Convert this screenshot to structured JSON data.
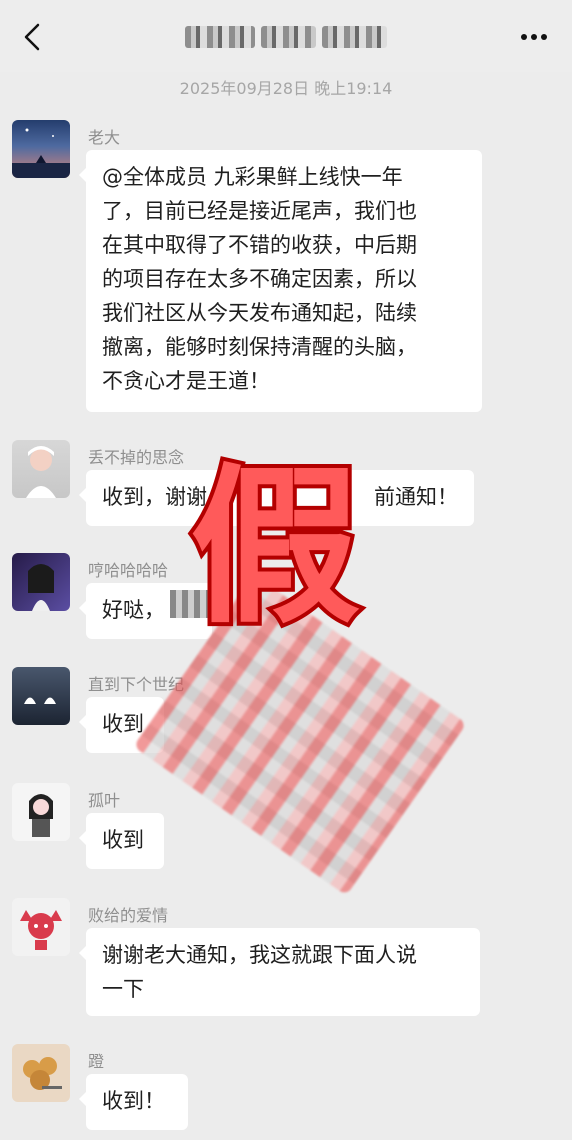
{
  "header": {
    "back_icon": "chevron-left-icon",
    "more_icon": "more-horizontal-icon"
  },
  "timestamp": "2025年09月28日 晚上19:14",
  "messages": [
    {
      "sender": "老大",
      "text": "@全体成员 九彩果鲜上线快一年了，目前已经是接近尾声，我们也在其中取得了不错的收获，中后期的项目存在太多不确定因素，所以我们社区从今天发布通知起，陆续撤离，能够时刻保持清醒的头脑，不贪心才是王道！",
      "text_lines": [
        "@全体成员 九彩果鲜上线快一年",
        "了，目前已经是接近尾声，我们也",
        "在其中取得了不错的收获，中后期",
        "的项目存在太多不确定因素，所以",
        "我们社区从今天发布通知起，陆续",
        "撤离，能够时刻保持清醒的头脑，",
        "不贪心才是王道！"
      ]
    },
    {
      "sender": "丢不掉的思念",
      "text": "收到，谢谢老大提前通知！",
      "visible_left": "收到，谢谢",
      "visible_right": "前通知！"
    },
    {
      "sender": "哼哈哈哈哈",
      "text": "好哒，"
    },
    {
      "sender": "直到下个世纪",
      "text": "收到"
    },
    {
      "sender": "孤叶",
      "text": "收到"
    },
    {
      "sender": "败给的爱情",
      "text": "谢谢老大通知，我这就跟下面人说一下",
      "text_lines": [
        "谢谢老大通知，我这就跟下面人说",
        "一下"
      ]
    },
    {
      "sender": "蹬",
      "text": "收到！"
    }
  ],
  "overlay": {
    "big_label": "假"
  },
  "colors": {
    "background": "#ececec",
    "bubble": "#ffffff",
    "watermark_red": "#ff5a5a"
  }
}
